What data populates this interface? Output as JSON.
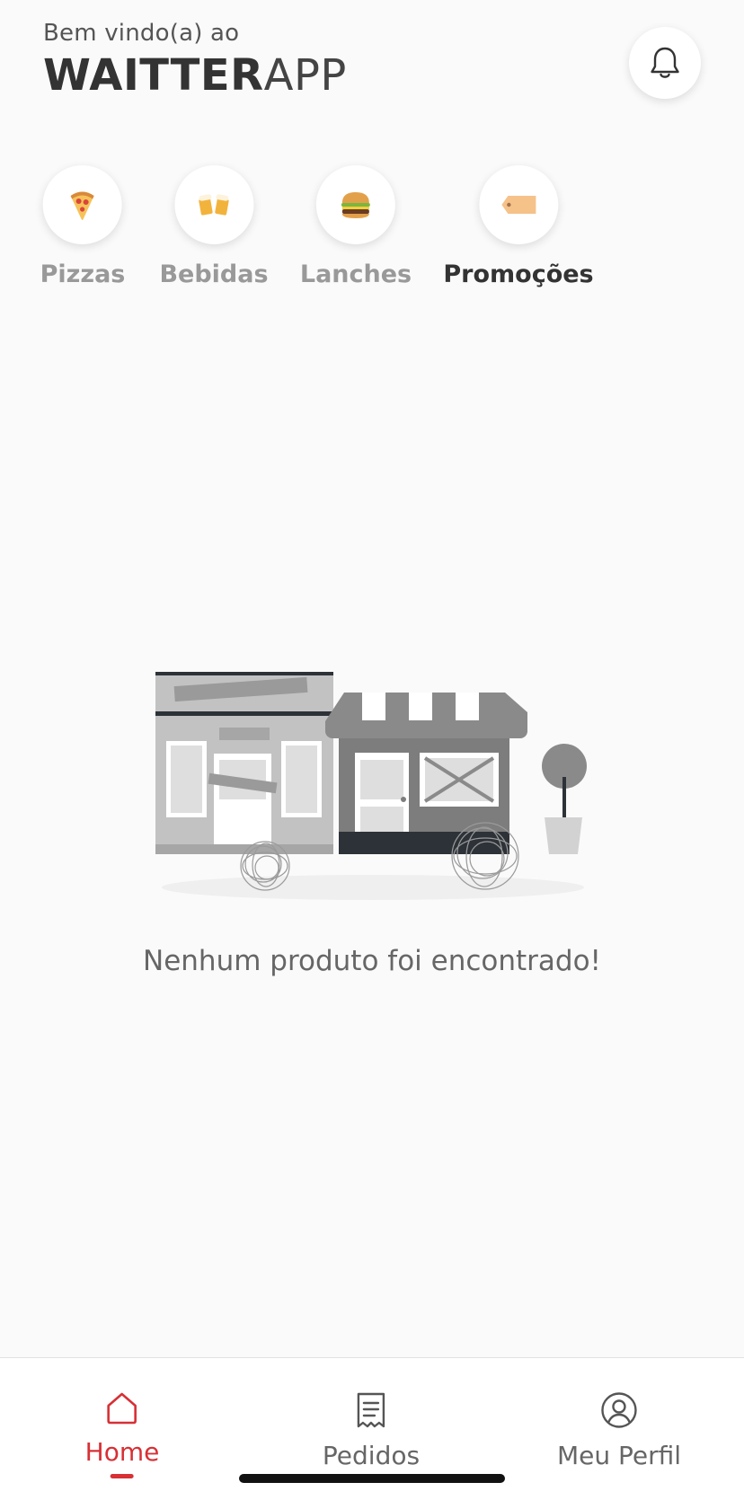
{
  "header": {
    "welcome": "Bem vindo(a) ao",
    "brand_bold": "WAITTER",
    "brand_light": "APP"
  },
  "notifications": {
    "icon": "bell-icon"
  },
  "categories": [
    {
      "label": "Pizzas",
      "icon": "pizza-icon",
      "selected": false
    },
    {
      "label": "Bebidas",
      "icon": "beer-mugs-icon",
      "selected": false
    },
    {
      "label": "Lanches",
      "icon": "burger-icon",
      "selected": false
    },
    {
      "label": "Promoções",
      "icon": "price-tag-icon",
      "selected": true
    }
  ],
  "empty_state": {
    "message": "Nenhum produto foi encontrado!",
    "illustration": "closed-stores-illustration"
  },
  "tabbar": {
    "items": [
      {
        "label": "Home",
        "icon": "home-icon",
        "active": true
      },
      {
        "label": "Pedidos",
        "icon": "orders-icon",
        "active": false
      },
      {
        "label": "Meu Perfil",
        "icon": "profile-icon",
        "active": false
      }
    ]
  },
  "colors": {
    "accent": "#d73035",
    "background": "#fafafa",
    "text_dark": "#333333",
    "text_muted": "#999999"
  }
}
